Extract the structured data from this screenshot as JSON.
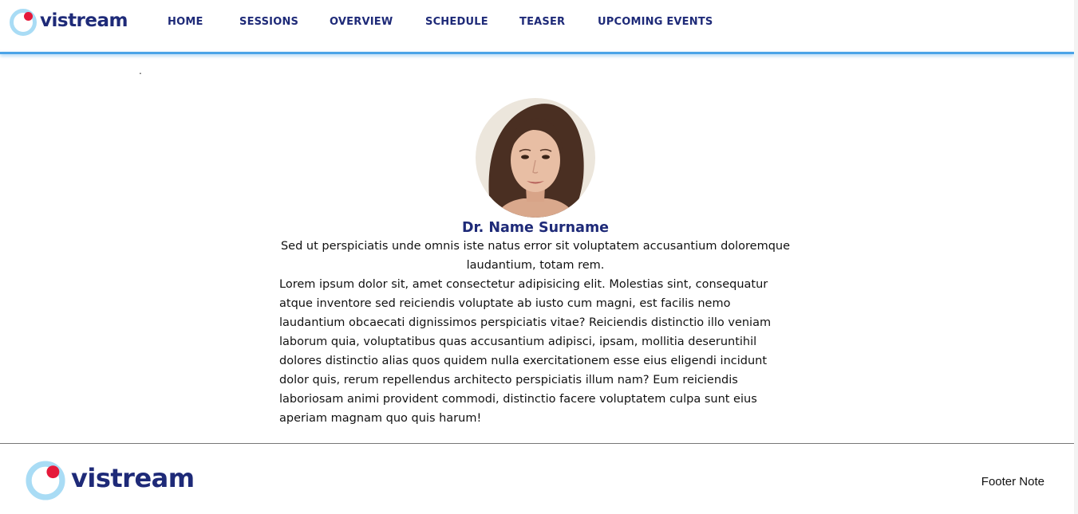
{
  "brand": {
    "name": "vistream",
    "ring_color": "#a9dcf5",
    "dot_color": "#e5193a",
    "text_color": "#1e2a78"
  },
  "nav": [
    {
      "label": "HOME"
    },
    {
      "label": "SESSIONS"
    },
    {
      "label": "OVERVIEW"
    },
    {
      "label": "SCHEDULE"
    },
    {
      "label": "TEASER"
    },
    {
      "label": "UPCOMING EVENTS"
    }
  ],
  "accent_color": "#4aa3e8",
  "stray_mark": ".",
  "speaker": {
    "name": "Dr. Name Surname",
    "subtitle": "Sed ut perspiciatis unde omnis iste natus error sit voluptatem accusantium doloremque laudantium, totam rem.",
    "bio": "Lorem ipsum dolor sit, amet consectetur adipisicing elit. Molestias sint, consequatur atque inventore sed reiciendis voluptate ab iusto cum magni, est facilis nemo laudantium obcaecati dignissimos perspiciatis vitae? Reiciendis distinctio illo veniam laborum quia, voluptatibus quas accusantium adipisci, ipsam, mollitia deseruntihil dolores distinctio alias quos quidem nulla exercitationem esse eius eligendi incidunt dolor quis, rerum repellendus architecto perspiciatis illum nam? Eum reiciendis laboriosam animi provident commodi, distinctio facere voluptatem culpa sunt eius aperiam magnam quo quis harum!"
  },
  "footer": {
    "note": "Footer Note"
  }
}
